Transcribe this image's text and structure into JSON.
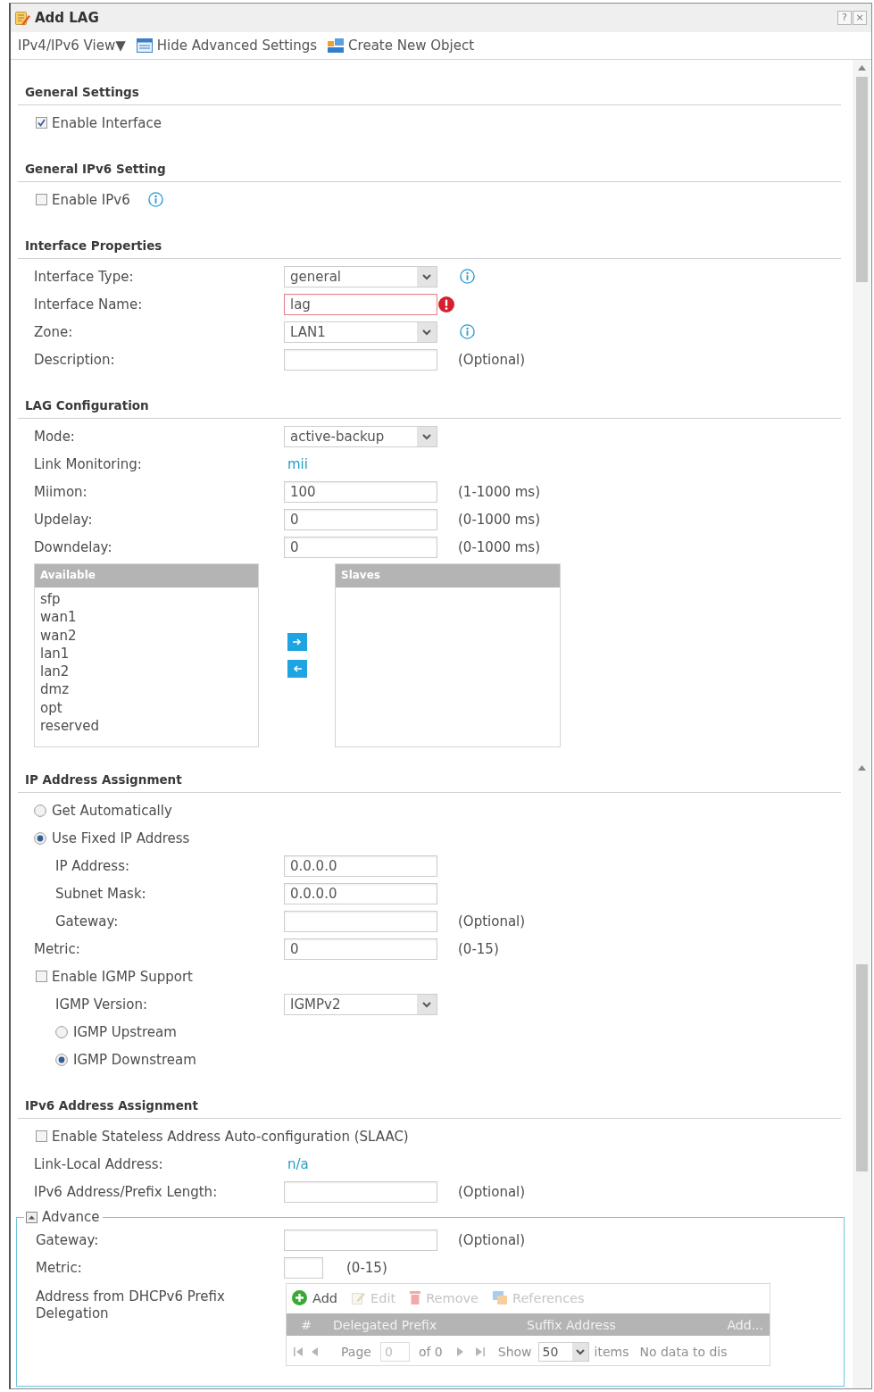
{
  "window": {
    "title": "Add LAG",
    "help": "?",
    "close": "×"
  },
  "toolbar": [
    {
      "kind": "menu",
      "label": "IPv4/IPv6 View▼"
    },
    {
      "kind": "panel",
      "label": "Hide Advanced Settings"
    },
    {
      "kind": "object",
      "label": "Create New Object"
    }
  ],
  "sections": [
    {
      "title": "General Settings",
      "rows": [
        {
          "kind": "checkbox",
          "label": "Enable Interface",
          "checked": true
        }
      ]
    },
    {
      "title": "General IPv6 Setting",
      "rows": [
        {
          "kind": "checkbox",
          "label": "Enable IPv6",
          "checked": false,
          "info": true
        }
      ]
    },
    {
      "title": "Interface Properties",
      "rows": [
        {
          "kind": "select",
          "label": "Interface Type:",
          "value": "general",
          "info": true
        },
        {
          "kind": "input",
          "label": "Interface Name:",
          "value": "lag",
          "error": true
        },
        {
          "kind": "select",
          "label": "Zone:",
          "value": "LAN1",
          "info": true
        },
        {
          "kind": "input",
          "label": "Description:",
          "note": "(Optional)"
        }
      ]
    },
    {
      "title": "LAG Configuration",
      "rows": [
        {
          "kind": "select",
          "label": "Mode:",
          "value": "active-backup"
        },
        {
          "kind": "text",
          "label": "Link Monitoring:",
          "value": "mii"
        },
        {
          "kind": "input",
          "label": "Miimon:",
          "value": "100",
          "note": "(1-1000 ms)"
        },
        {
          "kind": "input",
          "label": "Updelay:",
          "value": "0",
          "note": "(0-1000 ms)"
        },
        {
          "kind": "input",
          "label": "Downdelay:",
          "value": "0",
          "note": "(0-1000 ms)"
        },
        {
          "kind": "lists",
          "available": {
            "title": "Available",
            "items": [
              "sfp",
              "wan1",
              "wan2",
              "lan1",
              "lan2",
              "dmz",
              "opt",
              "reserved"
            ]
          },
          "members": {
            "title": "Slaves"
          }
        }
      ]
    },
    {
      "title": "IP Address Assignment",
      "rows": [
        {
          "kind": "radio",
          "label": "Get Automatically",
          "selected": false
        },
        {
          "kind": "radio",
          "label": "Use Fixed IP Address",
          "selected": true,
          "children": [
            {
              "kind": "input",
              "label": "IP Address:",
              "value": "0.0.0.0"
            },
            {
              "kind": "input",
              "label": "Subnet Mask:",
              "value": "0.0.0.0"
            },
            {
              "kind": "input",
              "label": "Gateway:",
              "note": "(Optional)"
            }
          ]
        },
        {
          "kind": "input",
          "label": "Metric:",
          "value": "0",
          "note": "(0-15)"
        },
        {
          "kind": "checkbox",
          "label": "Enable IGMP Support",
          "checked": false,
          "children": [
            {
              "kind": "select",
              "label": "IGMP Version:",
              "value": "IGMPv2"
            },
            {
              "kind": "radio",
              "label": "IGMP Upstream",
              "selected": false
            },
            {
              "kind": "radio",
              "label": "IGMP Downstream",
              "selected": true
            }
          ]
        }
      ]
    },
    {
      "title": "IPv6 Address Assignment",
      "rows": [
        {
          "kind": "checkbox",
          "label": "Enable Stateless Address Auto-configuration (SLAAC)",
          "checked": false
        },
        {
          "kind": "text",
          "label": "Link-Local Address:",
          "value": "n/a"
        },
        {
          "kind": "input",
          "label": "IPv6 Address/Prefix Length:",
          "note": "(Optional)"
        },
        {
          "kind": "fieldset",
          "legend": "Advance",
          "expanded": true,
          "children": [
            {
              "kind": "input",
              "label": "Gateway:",
              "note": "(Optional)"
            },
            {
              "kind": "number",
              "label": "Metric:",
              "note": "(0-15)"
            },
            {
              "kind": "grid",
              "label": "Address from DHCPv6 Prefix Delegation",
              "actions": [
                {
                  "kind": "add",
                  "label": "Add",
                  "disabled": false
                },
                {
                  "kind": "edit",
                  "label": "Edit",
                  "disabled": true
                },
                {
                  "kind": "remove",
                  "label": "Remove",
                  "disabled": true
                },
                {
                  "kind": "references",
                  "label": "References",
                  "disabled": true
                }
              ],
              "columns": [
                "#",
                "Delegated Prefix",
                "Suffix Address",
                "Add..."
              ],
              "pager": {
                "page_label": "Page",
                "page": "0",
                "page_total": "of 0",
                "show_label": "Show",
                "page_size": "50",
                "items_label": "items",
                "message": "No data to dis"
              }
            }
          ]
        }
      ]
    }
  ]
}
